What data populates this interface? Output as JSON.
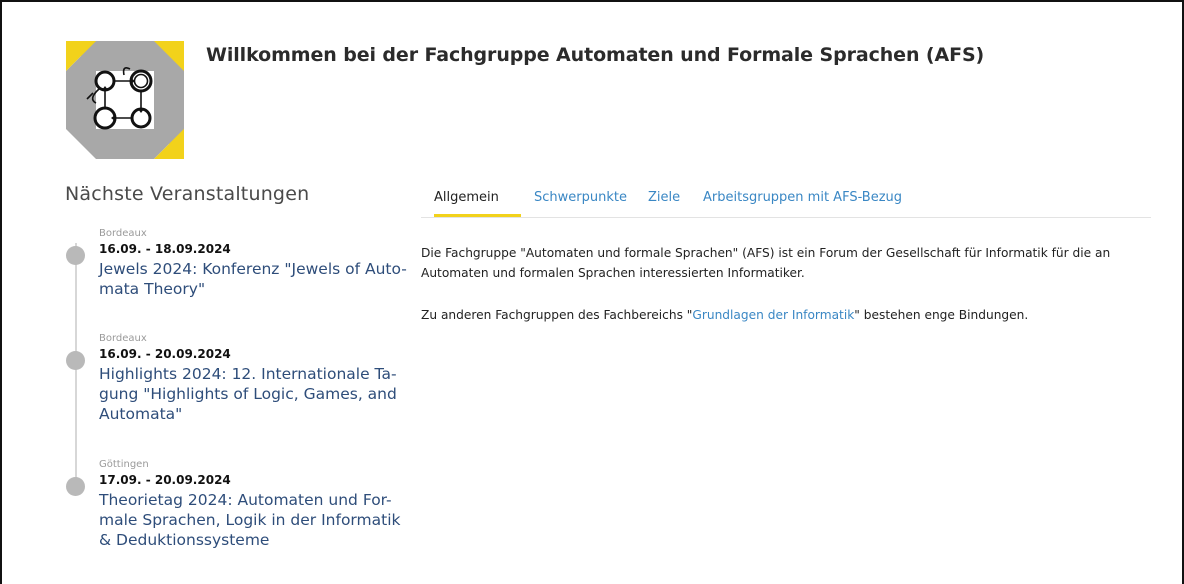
{
  "header": {
    "title": "Willkommen bei der Fachgruppe Automaten und Formale Sprachen (AFS)"
  },
  "sidebar": {
    "heading": "Nächste Veranstaltungen",
    "events": [
      {
        "location": "Bordeaux",
        "date": "16.09. - 18.09.2024",
        "title": "Jewels 2024: Konferenz \"Jewels of Auto-mata Theory\""
      },
      {
        "location": "Bordeaux",
        "date": "16.09. - 20.09.2024",
        "title": "Highlights 2024: 12. Internationale Ta-gung \"Highlights of Logic, Games, and Automata\""
      },
      {
        "location": "Göttingen",
        "date": "17.09. - 20.09.2024",
        "title": "Theorietag 2024: Automaten und For-male Sprachen, Logik in der Informatik & Deduktionssysteme"
      }
    ]
  },
  "tabs": [
    {
      "label": "Allgemein",
      "active": true
    },
    {
      "label": "Schwerpunkte",
      "active": false
    },
    {
      "label": "Ziele",
      "active": false
    },
    {
      "label": "Arbeitsgruppen mit AFS-Bezug",
      "active": false
    }
  ],
  "content": {
    "paragraph1": "Die Fachgruppe \"Automaten und formale Sprachen\" (AFS) ist ein Forum der Gesellschaft für Informatik für die an Automaten und formalen Sprachen interessierten Informatiker.",
    "paragraph2_before": "Zu anderen Fachgruppen des Fachbereichs \"",
    "paragraph2_link": "Grundlagen der Informatik",
    "paragraph2_after": "\" bestehen enge Bindungen."
  },
  "colors": {
    "accent_yellow": "#f2d21b",
    "link_blue": "#3a87c4",
    "event_title_blue": "#2e4d7a",
    "logo_gray": "#a8a8a8"
  }
}
